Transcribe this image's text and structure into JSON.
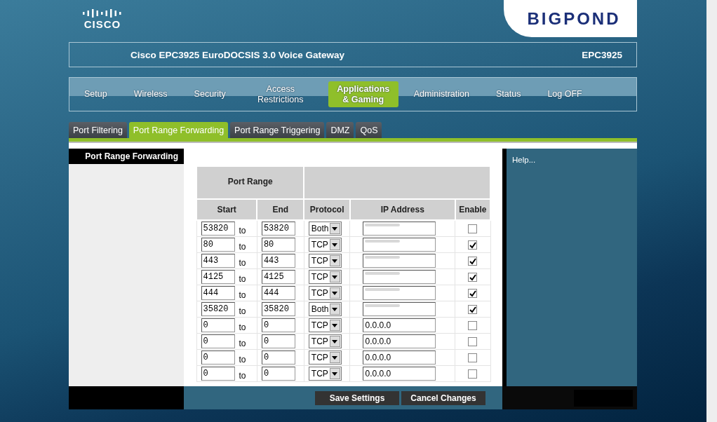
{
  "header": {
    "logo_text": "CISCO",
    "partner_logo": "BIGPOND",
    "device_title": "Cisco EPC3925 EuroDOCSIS 3.0 Voice Gateway",
    "model": "EPC3925"
  },
  "nav": [
    {
      "label": "Setup",
      "selected": false
    },
    {
      "label": "Wireless",
      "selected": false
    },
    {
      "label": "Security",
      "selected": false
    },
    {
      "label": "Access Restrictions",
      "selected": false
    },
    {
      "label": "Applications & Gaming",
      "selected": true
    },
    {
      "label": "Administration",
      "selected": false
    },
    {
      "label": "Status",
      "selected": false
    },
    {
      "label": "Log OFF",
      "selected": false
    }
  ],
  "subtabs": [
    {
      "label": "Port Filtering",
      "selected": false
    },
    {
      "label": "Port Range Forwarding",
      "selected": true
    },
    {
      "label": "Port Range Triggering",
      "selected": false
    },
    {
      "label": "DMZ",
      "selected": false
    },
    {
      "label": "QoS",
      "selected": false
    }
  ],
  "section_title": "Port Range Forwarding",
  "help": "Help...",
  "table": {
    "group_header": "Port Range",
    "columns": [
      "Start",
      "End",
      "Protocol",
      "IP Address",
      "Enable"
    ],
    "rows": [
      {
        "start": "53820",
        "separator": "to",
        "end": "53820",
        "protocol": "Both",
        "redacted": true,
        "enabled": false
      },
      {
        "start": "80",
        "separator": "to",
        "end": "80",
        "protocol": "TCP",
        "redacted": true,
        "enabled": true
      },
      {
        "start": "443",
        "separator": "to",
        "end": "443",
        "protocol": "TCP",
        "redacted": true,
        "enabled": true
      },
      {
        "start": "4125",
        "separator": "to",
        "end": "4125",
        "protocol": "TCP",
        "redacted": true,
        "enabled": true
      },
      {
        "start": "444",
        "separator": "to",
        "end": "444",
        "protocol": "TCP",
        "redacted": true,
        "enabled": true
      },
      {
        "start": "35820",
        "separator": "to",
        "end": "35820",
        "protocol": "Both",
        "redacted": true,
        "enabled": true
      },
      {
        "start": "0",
        "separator": "to",
        "end": "0",
        "protocol": "TCP",
        "ip": "0.0.0.0",
        "redacted": false,
        "enabled": false
      },
      {
        "start": "0",
        "separator": "to",
        "end": "0",
        "protocol": "TCP",
        "ip": "0.0.0.0",
        "redacted": false,
        "enabled": false
      },
      {
        "start": "0",
        "separator": "to",
        "end": "0",
        "protocol": "TCP",
        "ip": "0.0.0.0",
        "redacted": false,
        "enabled": false
      },
      {
        "start": "0",
        "separator": "to",
        "end": "0",
        "protocol": "TCP",
        "ip": "0.0.0.0",
        "redacted": false,
        "enabled": false
      }
    ]
  },
  "buttons": [
    "Save Settings",
    "Cancel Changes"
  ]
}
